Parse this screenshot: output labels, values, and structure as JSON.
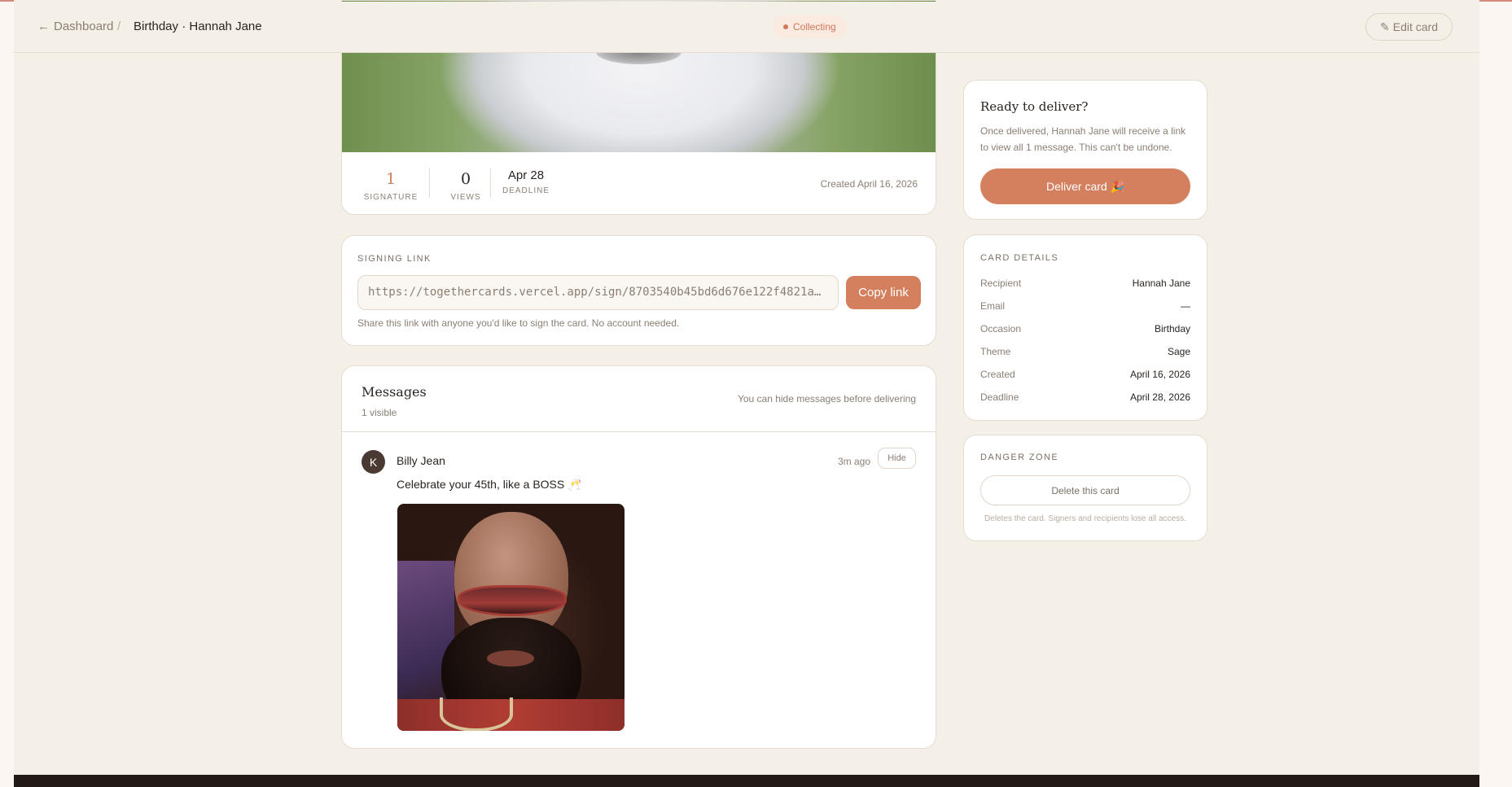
{
  "header": {
    "back_label": "Dashboard",
    "separator": "/",
    "title": "Birthday · Hannah Jane",
    "status": "Collecting",
    "edit_label": "Edit card",
    "edit_icon": "pencil-icon",
    "back_icon": "arrow-left-icon"
  },
  "stats": {
    "signatures": {
      "value": "1",
      "label": "Signature"
    },
    "views": {
      "value": "0",
      "label": "Views"
    },
    "deadline": {
      "value": "Apr 28",
      "label": "Deadline"
    },
    "created": "Created April 16, 2026"
  },
  "signing_link": {
    "label": "Signing link",
    "url": "https://togethercards.vercel.app/sign/8703540b45bd6d676e122f4821a…",
    "copy_label": "Copy link",
    "hint": "Share this link with anyone you'd like to sign the card. No account needed."
  },
  "messages": {
    "title": "Messages",
    "count": "1 visible",
    "note": "You can hide messages before delivering",
    "items": [
      {
        "avatar_initial": "K",
        "author": "Billy Jean",
        "time": "3m ago",
        "hide_label": "Hide",
        "text": "Celebrate your 45th, like a BOSS 🥂"
      }
    ]
  },
  "deliver": {
    "title": "Ready to deliver?",
    "description": "Once delivered, Hannah Jane will receive a link to view all 1 message. This can't be undone.",
    "button_label": "Deliver card 🎉"
  },
  "card_details": {
    "label": "Card details",
    "rows": [
      {
        "key": "Recipient",
        "value": "Hannah Jane"
      },
      {
        "key": "Email",
        "value": "—"
      },
      {
        "key": "Occasion",
        "value": "Birthday"
      },
      {
        "key": "Theme",
        "value": "Sage"
      },
      {
        "key": "Created",
        "value": "April 16, 2026"
      },
      {
        "key": "Deadline",
        "value": "April 28, 2026"
      }
    ]
  },
  "danger_zone": {
    "label": "Danger zone",
    "delete_label": "Delete this card",
    "note": "Deletes the card. Signers and recipients lose all access."
  },
  "colors": {
    "accent": "#d4805f",
    "background": "#f4efe7",
    "status_text": "#d0775f",
    "status_bg": "#faeadf"
  }
}
